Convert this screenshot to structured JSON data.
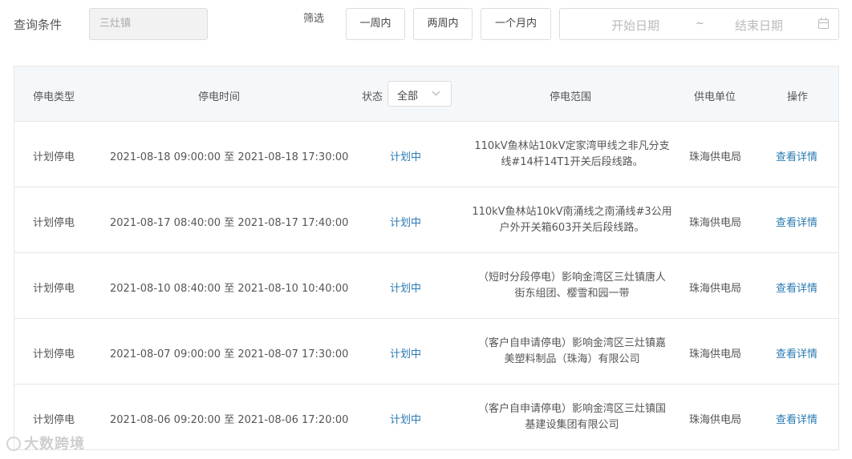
{
  "query": {
    "label": "查询条件",
    "town_value": "三灶镇",
    "filter_label": "筛选",
    "buttons": {
      "week": "一周内",
      "two_weeks": "两周内",
      "month": "一个月内"
    },
    "date_range": {
      "start_placeholder": "开始日期",
      "separator": "~",
      "end_placeholder": "结束日期"
    }
  },
  "table": {
    "headers": {
      "type": "停电类型",
      "time": "停电时间",
      "status": "状态",
      "status_filter": "全部",
      "range": "停电范围",
      "unit": "供电单位",
      "op": "操作"
    },
    "rows": [
      {
        "type": "计划停电",
        "time": "2021-08-18 09:00:00 至 2021-08-18 17:30:00",
        "status": "计划中",
        "range_1": "110kV鱼林站10kV定家湾甲线之非凡分支",
        "range_2": "线#14杆14T1开关后段线路。",
        "unit": "珠海供电局",
        "op": "查看详情"
      },
      {
        "type": "计划停电",
        "time": "2021-08-17 08:40:00 至 2021-08-17 17:40:00",
        "status": "计划中",
        "range_1": "110kV鱼林站10kV南涌线之南涌线#3公用",
        "range_2": "户外开关箱603开关后段线路。",
        "unit": "珠海供电局",
        "op": "查看详情"
      },
      {
        "type": "计划停电",
        "time": "2021-08-10 08:40:00 至 2021-08-10 10:40:00",
        "status": "计划中",
        "range_1": "（短时分段停电）影响金湾区三灶镇唐人",
        "range_2": "街东组团、樱雪和园一带",
        "unit": "珠海供电局",
        "op": "查看详情"
      },
      {
        "type": "计划停电",
        "time": "2021-08-07 09:00:00 至 2021-08-07 17:30:00",
        "status": "计划中",
        "range_1": "（客户自申请停电）影响金湾区三灶镇嘉",
        "range_2": "美塑料制品（珠海）有限公司",
        "unit": "珠海供电局",
        "op": "查看详情"
      },
      {
        "type": "计划停电",
        "time": "2021-08-06 09:20:00 至 2021-08-06 17:20:00",
        "status": "计划中",
        "range_1": "（客户自申请停电）影响金湾区三灶镇国",
        "range_2": "基建设集团有限公司",
        "unit": "珠海供电局",
        "op": "查看详情"
      }
    ]
  },
  "watermark": "大数跨境"
}
